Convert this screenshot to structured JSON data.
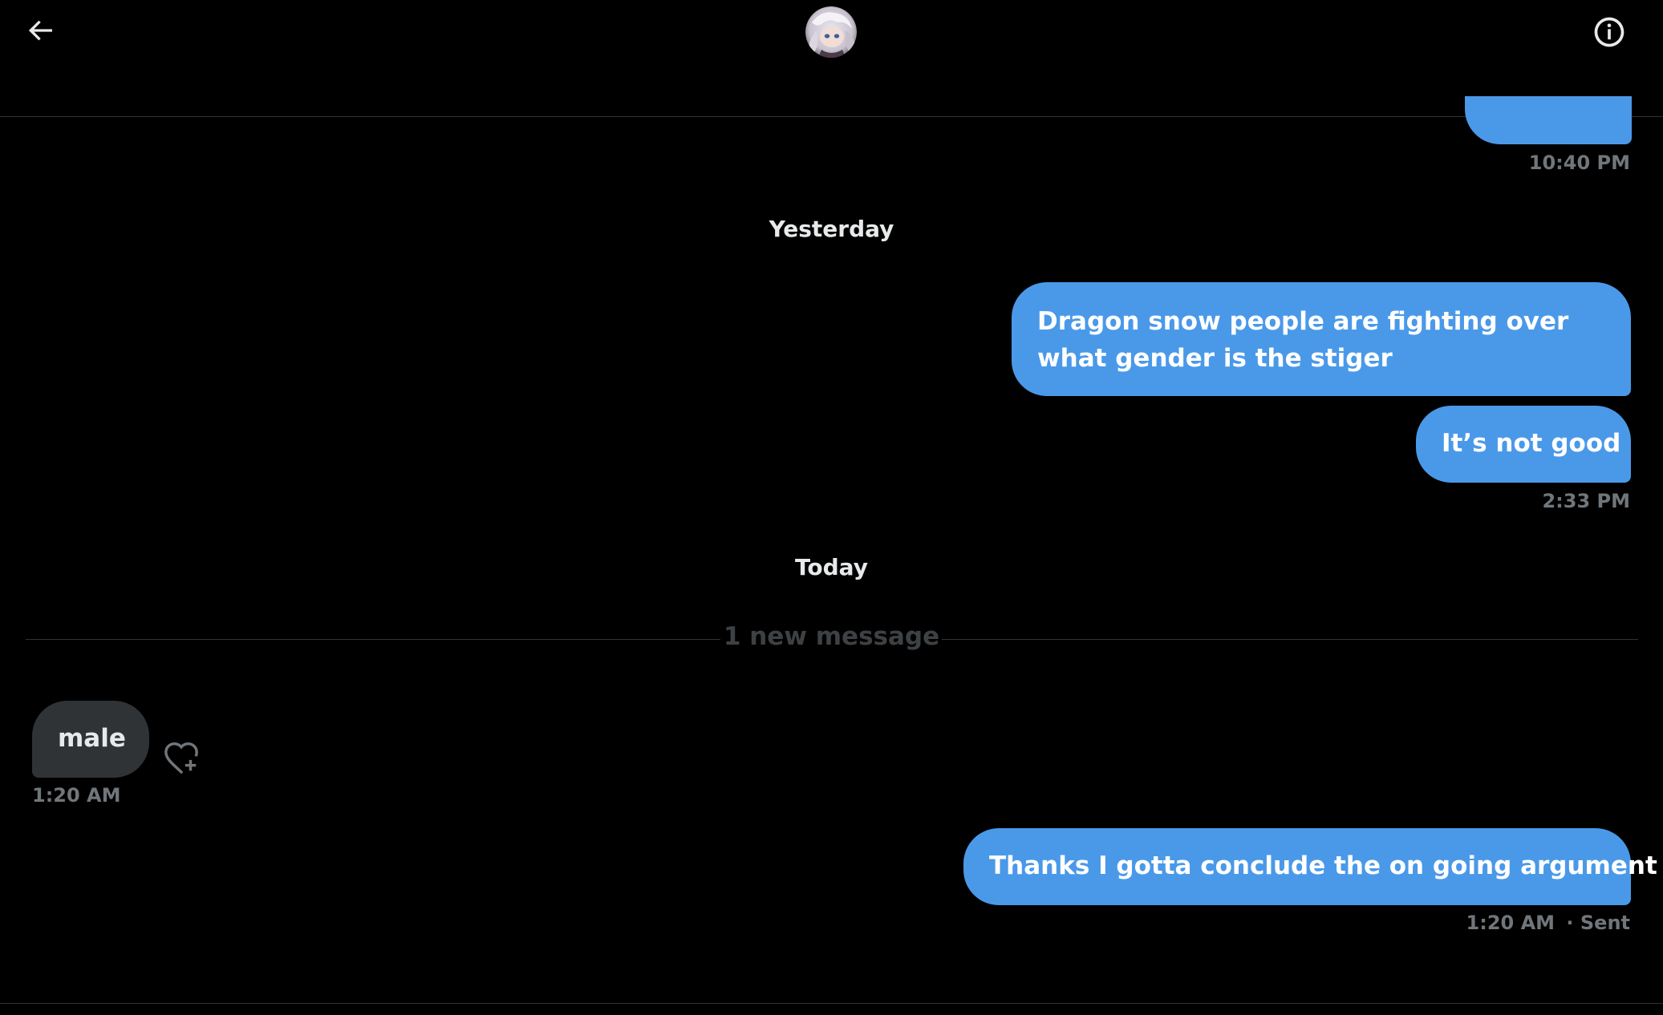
{
  "header": {
    "back_icon": "arrow-left-icon",
    "info_icon": "info-icon",
    "avatar_icon": "profile-avatar"
  },
  "messages": {
    "partial_sent_time": "10:40 PM",
    "yesterday_label": "Yesterday",
    "sent_1": "Dragon snow people are fighting over what gender is the stiger",
    "sent_2": "It’s not good",
    "sent_2_time": "2:33 PM",
    "today_label": "Today",
    "new_message_label": "1 new message",
    "received_1": "male",
    "received_1_time": "1:20 AM",
    "react_icon": "heart-plus-icon",
    "sent_3": "Thanks I gotta conclude the on going argument",
    "sent_3_time": "1:20 AM",
    "sent_3_status": "· Sent"
  },
  "colors": {
    "sent_bubble": "#4a99e9",
    "received_bubble": "#2f3336",
    "timestamp": "#71767b",
    "background": "#000000"
  }
}
